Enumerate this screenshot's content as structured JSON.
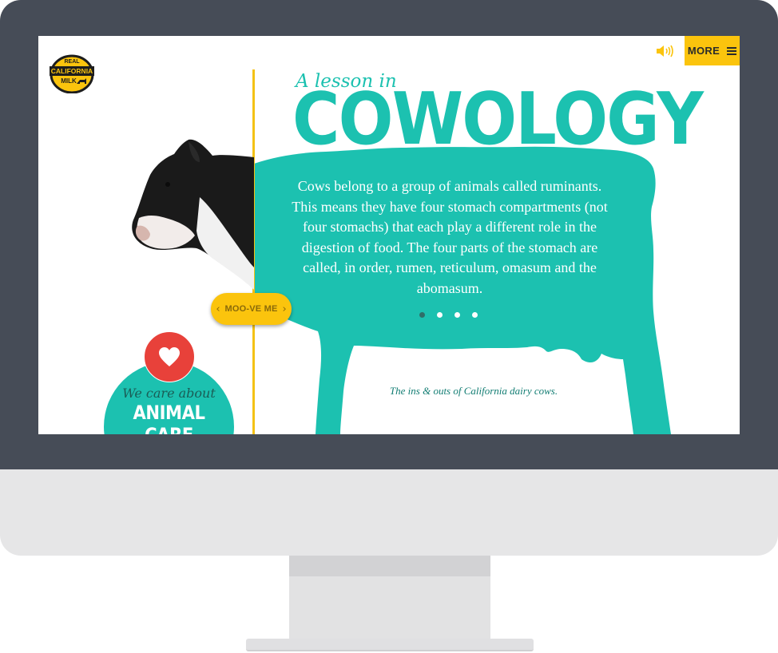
{
  "logo": {
    "line1": "REAL",
    "line2": "CALIFORNIA",
    "line3": "MILK"
  },
  "header": {
    "more_label": "MORE",
    "sound_icon": "speaker-icon",
    "menu_icon": "hamburger-icon"
  },
  "hero": {
    "subtitle": "A lesson in",
    "title": "COWOLOGY",
    "body": "Cows belong to a group of animals called ruminants. This means they have four stomach compartments (not four stomachs) that each play a different role in the digestion of food. The four parts of the stomach are called, in order, rumen, reticulum, omasum and the abomasum.",
    "caption": "The ins & outs of California dairy cows."
  },
  "slider": {
    "label": "MOO-VE ME",
    "left_icon": "chevron-left-icon",
    "right_icon": "chevron-right-icon"
  },
  "pagination": {
    "count": 4,
    "active_index": 0
  },
  "care": {
    "subtitle": "We care about",
    "title": "ANIMAL CARE",
    "icon": "heart-icon"
  },
  "colors": {
    "teal": "#1cc1b0",
    "yellow": "#fbc40d",
    "red": "#e8413a",
    "bezel": "#464c57"
  }
}
